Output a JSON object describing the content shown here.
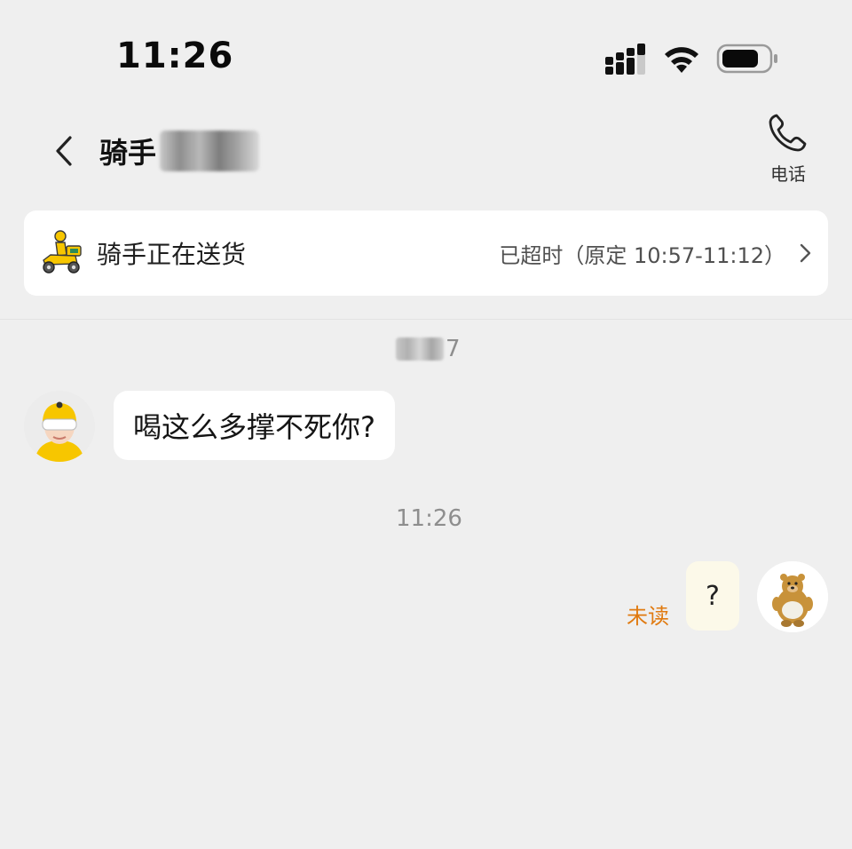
{
  "status_bar": {
    "time": "11:26",
    "icons": [
      "signal-icon",
      "wifi-icon",
      "battery-icon"
    ]
  },
  "header": {
    "back_icon": "chevron-left-icon",
    "title": "骑手",
    "phone_icon": "phone-icon",
    "phone_label": "电话"
  },
  "delivery_card": {
    "icon": "scooter-icon",
    "status": "骑手正在送货",
    "time_info": "已超时（原定 10:57-11:12）",
    "chevron_icon": "chevron-right-icon"
  },
  "chat": {
    "messages": [
      {
        "timestamp_visible": "7",
        "sender": "rider",
        "text": "喝这么多撑不死你?"
      },
      {
        "timestamp": "11:26",
        "sender": "me",
        "text": "?",
        "read_status": "未读"
      }
    ]
  },
  "colors": {
    "background": "#efefef",
    "card": "#ffffff",
    "unread": "#e07a10",
    "outgoing_bubble": "#fcf9e9",
    "accent_yellow": "#f7c600"
  }
}
